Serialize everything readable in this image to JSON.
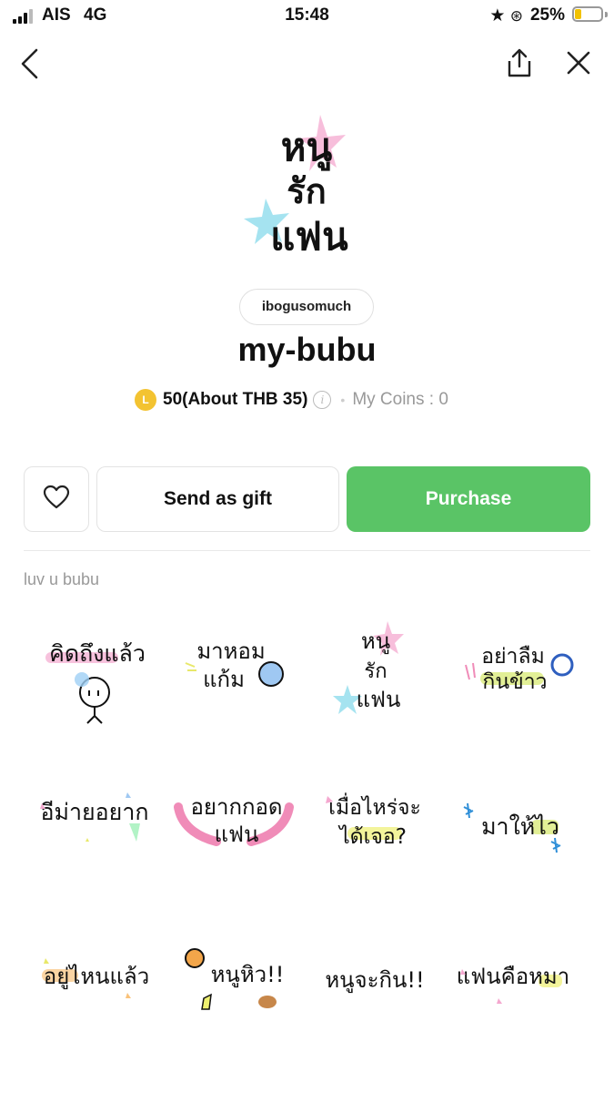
{
  "status_bar": {
    "carrier": "AIS",
    "network": "4G",
    "time": "15:48",
    "icons": [
      "star-icon",
      "rotation-lock-icon"
    ],
    "battery_percent": "25%",
    "battery_level": 0.25,
    "battery_color": "#f2c200"
  },
  "nav": {
    "back_icon": "chevron-left-icon",
    "share_icon": "share-icon",
    "close_icon": "close-icon"
  },
  "product": {
    "cover_text": [
      "หนู",
      "รัก",
      "แฟน"
    ],
    "creator": "ibogusomuch",
    "title": "my-bubu",
    "coin_letter": "L",
    "price": "50(About THB 35)",
    "my_coins": "My Coins : 0",
    "coin_color": "#f3c331"
  },
  "actions": {
    "favorite_icon": "heart-outline-icon",
    "gift_label": "Send as gift",
    "purchase_label": "Purchase",
    "purchase_color": "#5ac466"
  },
  "description": "luv u bubu",
  "stickers": [
    {
      "lines": [
        "คิดถึงแล้ว"
      ]
    },
    {
      "lines": [
        "มาหอม",
        "แก้ม"
      ]
    },
    {
      "lines": [
        "หนู",
        "รัก",
        "แฟน"
      ]
    },
    {
      "lines": [
        "อย่าลืม",
        "กินข้าว"
      ]
    },
    {
      "lines": [
        "อีม่ายอยาก"
      ]
    },
    {
      "lines": [
        "อยากกอด",
        "แฟน"
      ]
    },
    {
      "lines": [
        "เมื่อไหร่จะ",
        "ได้เจอ?"
      ]
    },
    {
      "lines": [
        "มาให้ไว"
      ]
    },
    {
      "lines": [
        "อยู่ไหนแล้ว"
      ]
    },
    {
      "lines": [
        "หนูหิว!!"
      ]
    },
    {
      "lines": [
        "หนูจะกิน!!"
      ]
    },
    {
      "lines": [
        "แฟนคือหมา"
      ]
    }
  ]
}
